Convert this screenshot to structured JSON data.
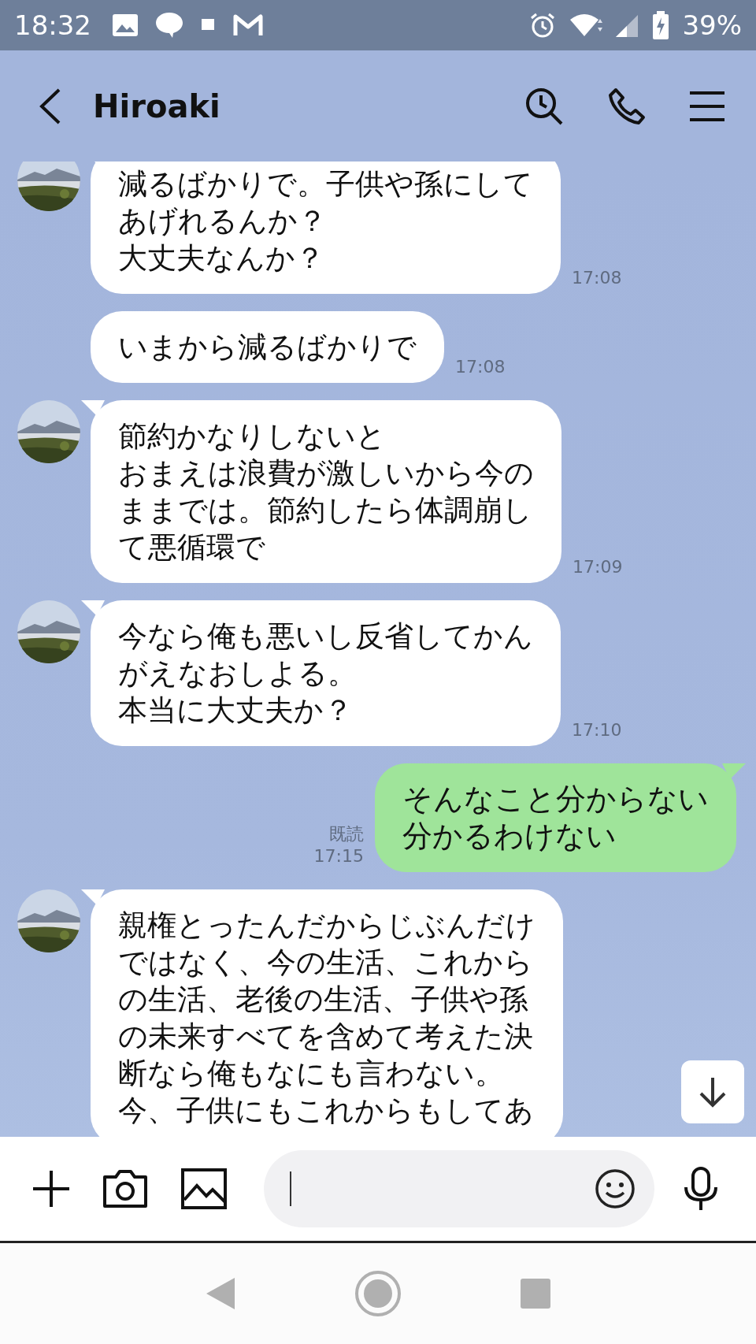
{
  "status_bar": {
    "time": "18:32",
    "battery": "39%"
  },
  "header": {
    "title": "Hiroaki"
  },
  "messages": [
    {
      "kind": "incoming",
      "avatar": true,
      "lines": [
        "減るばかりで。子供や孫にして",
        "あげれるんか？",
        "大丈夫なんか？"
      ],
      "time": "17:08"
    },
    {
      "kind": "incoming",
      "avatar": false,
      "lines": [
        "いまから減るばかりで"
      ],
      "time": "17:08"
    },
    {
      "kind": "incoming",
      "avatar": true,
      "lines": [
        "節約かなりしないと",
        "おまえは浪費が激しいから今の",
        "ままでは。節約したら体調崩し",
        "て悪循環で"
      ],
      "time": "17:09"
    },
    {
      "kind": "incoming",
      "avatar": true,
      "lines": [
        "今なら俺も悪いし反省してかん",
        "がえなおしよる。",
        "本当に大丈夫か？"
      ],
      "time": "17:10"
    },
    {
      "kind": "outgoing",
      "read_label": "既読",
      "lines": [
        "そんなこと分からない",
        "分かるわけない"
      ],
      "time": "17:15"
    },
    {
      "kind": "incoming",
      "avatar": true,
      "lines": [
        "親権とったんだからじぶんだけ",
        "ではなく、今の生活、これから",
        "の生活、老後の生活、子供や孫",
        "の未来すべてを含めて考えた決",
        "断なら俺もなにも言わない。",
        "今、子供にもこれからもしてあ"
      ]
    }
  ]
}
